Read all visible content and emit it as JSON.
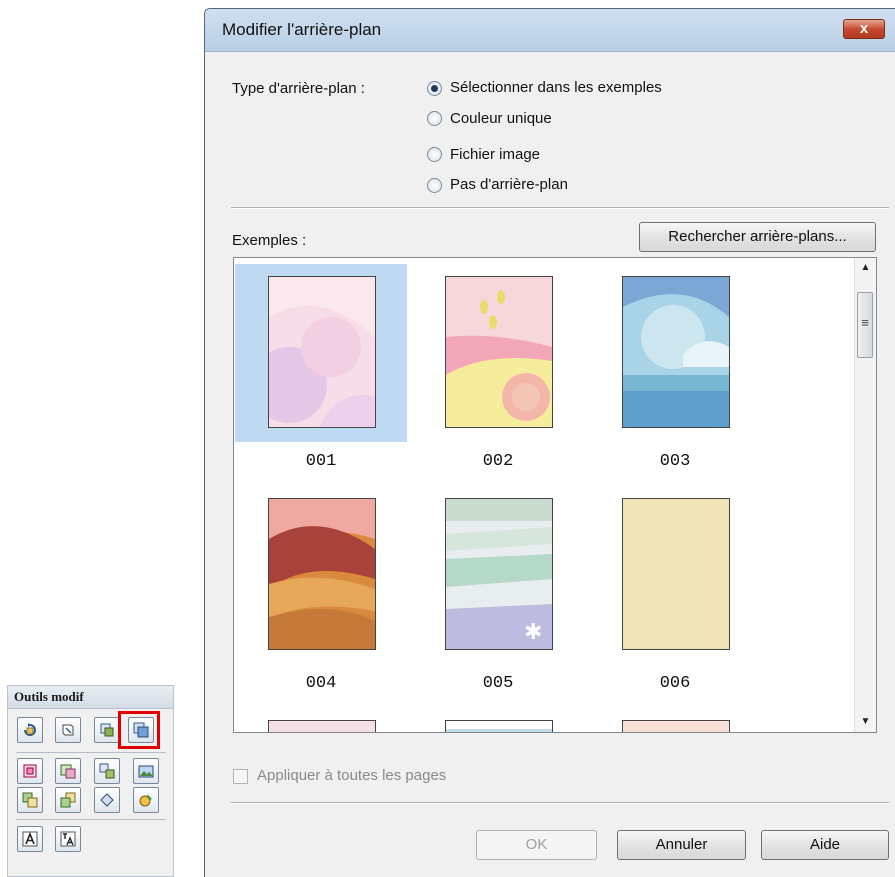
{
  "toolbox": {
    "title": "Outils modif",
    "highlight_color": "#e00000",
    "rows": [
      [
        "rotate-icon",
        "flip-icon",
        "layout-icon",
        "background-icon"
      ],
      [
        "crop-icon",
        "frame-icon",
        "replace-icon",
        "image-adjust-icon"
      ],
      [
        "front-icon",
        "back-icon",
        "rotate-free-icon",
        "color-icon"
      ],
      [
        "text-icon",
        "vertical-text-icon"
      ]
    ]
  },
  "dialog": {
    "title": "Modifier l'arrière-plan",
    "close_label": "x",
    "type_label": "Type d'arrière-plan :",
    "options": [
      {
        "label": "Sélectionner dans les exemples",
        "selected": true
      },
      {
        "label": "Couleur unique",
        "selected": false
      },
      {
        "label": "Fichier image",
        "selected": false
      },
      {
        "label": "Pas d'arrière-plan",
        "selected": false
      }
    ],
    "examples_label": "Exemples :",
    "browse_button": "Rechercher arrière-plans...",
    "examples": [
      {
        "label": "001",
        "selected": true
      },
      {
        "label": "002",
        "selected": false
      },
      {
        "label": "003",
        "selected": false
      },
      {
        "label": "004",
        "selected": false
      },
      {
        "label": "005",
        "selected": false
      },
      {
        "label": "006",
        "selected": false
      }
    ],
    "apply_all_label": "Appliquer à toutes les pages",
    "apply_all_checked": false,
    "ok_button": "OK",
    "cancel_button": "Annuler",
    "help_button": "Aide",
    "accent_color": "#bfd9f2"
  }
}
